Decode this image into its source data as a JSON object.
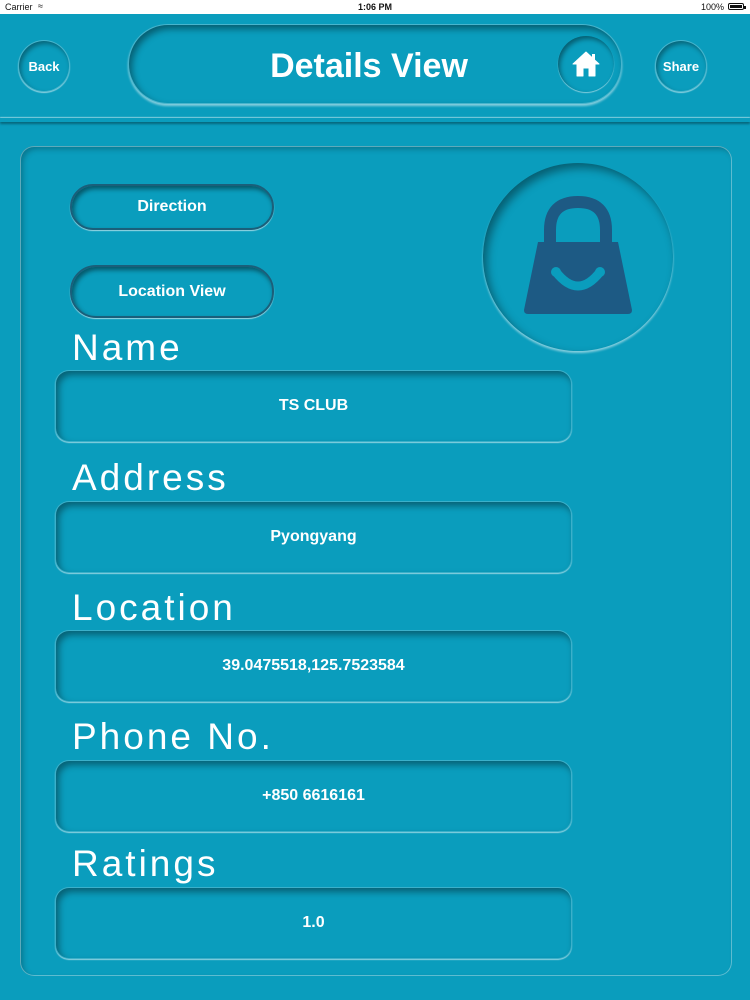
{
  "status_bar": {
    "carrier": "Carrier",
    "time": "1:06 PM",
    "battery": "100%"
  },
  "header": {
    "back_label": "Back",
    "title": "Details View",
    "share_label": "Share",
    "home_icon": "home-icon"
  },
  "actions": {
    "direction_label": "Direction",
    "location_view_label": "Location View"
  },
  "place_icon": "shopping-bag-icon",
  "fields": {
    "name": {
      "label": "Name",
      "value": "TS CLUB"
    },
    "address": {
      "label": "Address",
      "value": "Pyongyang"
    },
    "location": {
      "label": "Location",
      "value": "39.0475518,125.7523584"
    },
    "phone": {
      "label": "Phone No.",
      "value": "+850 6616161"
    },
    "ratings": {
      "label": "Ratings",
      "value": "1.0"
    }
  },
  "colors": {
    "background": "#0a9dbd",
    "text": "#ffffff",
    "icon_dark": "#1d5a84"
  }
}
